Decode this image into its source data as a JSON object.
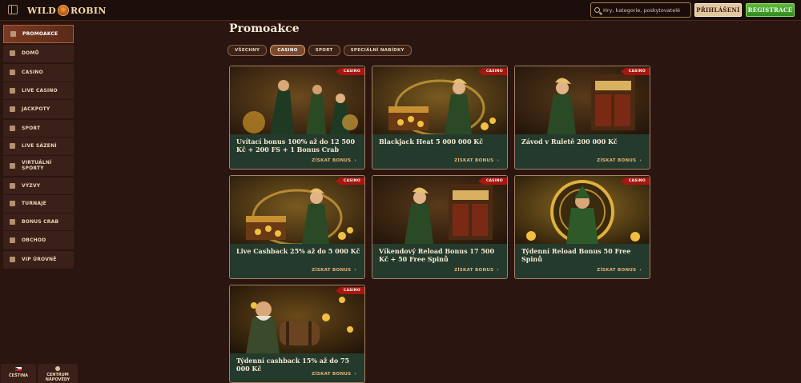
{
  "header": {
    "logo": "WILD ROBIN",
    "search_placeholder": "Hry, kategorie, poskytovatelé",
    "login": "PŘIHLÁŠENÍ",
    "register": "REGISTRACE"
  },
  "sidebar": {
    "groups": [
      [
        {
          "label": "PROMOAKCE",
          "icon": "gift-icon",
          "active": true
        }
      ],
      [
        {
          "label": "DOMŮ",
          "icon": "home-icon"
        }
      ],
      [
        {
          "label": "CASINO",
          "icon": "slot-icon"
        },
        {
          "label": "LIVE CASINO",
          "icon": "live-casino-icon"
        },
        {
          "label": "JACKPOTY",
          "icon": "jackpot-icon"
        }
      ],
      [
        {
          "label": "SPORT",
          "icon": "ball-icon"
        },
        {
          "label": "LIVE SÁZENÍ",
          "icon": "live-bet-icon"
        },
        {
          "label": "VIRTUÁLNÍ SPORTY",
          "icon": "virtual-sport-icon"
        }
      ],
      [
        {
          "label": "VÝZVY",
          "icon": "challenge-icon"
        },
        {
          "label": "TURNAJE",
          "icon": "trophy-icon"
        },
        {
          "label": "BONUS CRAB",
          "icon": "crab-icon"
        },
        {
          "label": "OBCHOD",
          "icon": "shop-icon"
        }
      ],
      [
        {
          "label": "VIP ÚROVNĚ",
          "icon": "vip-icon"
        }
      ]
    ],
    "language": "ČEŠTINA",
    "help": "CENTRUM NÁPOVĚDY"
  },
  "main": {
    "title": "Promoakce",
    "filters": [
      {
        "label": "VŠECHNY",
        "active": false
      },
      {
        "label": "CASINO",
        "active": true
      },
      {
        "label": "SPORT",
        "active": false
      },
      {
        "label": "SPECIÁLNÍ NABÍDKY",
        "active": false
      }
    ],
    "cards": [
      {
        "badge": "CASINO",
        "title": "Uvítací bonus 100% až do 12 500 Kč + 200 FS + 1 Bonus Crab",
        "cta": "ZÍSKAT BONUS",
        "image": "archers"
      },
      {
        "badge": "CASINO",
        "title": "Blackjack Heat 5 000 000 Kč",
        "cta": "ZÍSKAT BONUS",
        "image": "treasure"
      },
      {
        "badge": "CASINO",
        "title": "Závod v Ruletě 200 000 Kč",
        "cta": "ZÍSKAT BONUS",
        "image": "rollers"
      },
      {
        "badge": "CASINO",
        "title": "Live Cashback 25% až do 5 000 Kč",
        "cta": "ZÍSKAT BONUS",
        "image": "treasure"
      },
      {
        "badge": "CASINO",
        "title": "Víkendový Reload Bonus 17 500 Kč + 50 Free Spinů",
        "cta": "ZÍSKAT BONUS",
        "image": "rollers"
      },
      {
        "badge": "CASINO",
        "title": "Týdenní Reload Bonus 50 Free Spinů",
        "cta": "ZÍSKAT BONUS",
        "image": "wheel"
      },
      {
        "badge": "CASINO",
        "title": "Týdenní cashback 15% až do 75 000 Kč",
        "cta": "ZÍSKAT BONUS",
        "image": "barrel"
      }
    ]
  },
  "colors": {
    "background": "#2a1510",
    "card_footer": "#243a2c",
    "badge": "#a8160f",
    "register": "#3f9c26"
  }
}
